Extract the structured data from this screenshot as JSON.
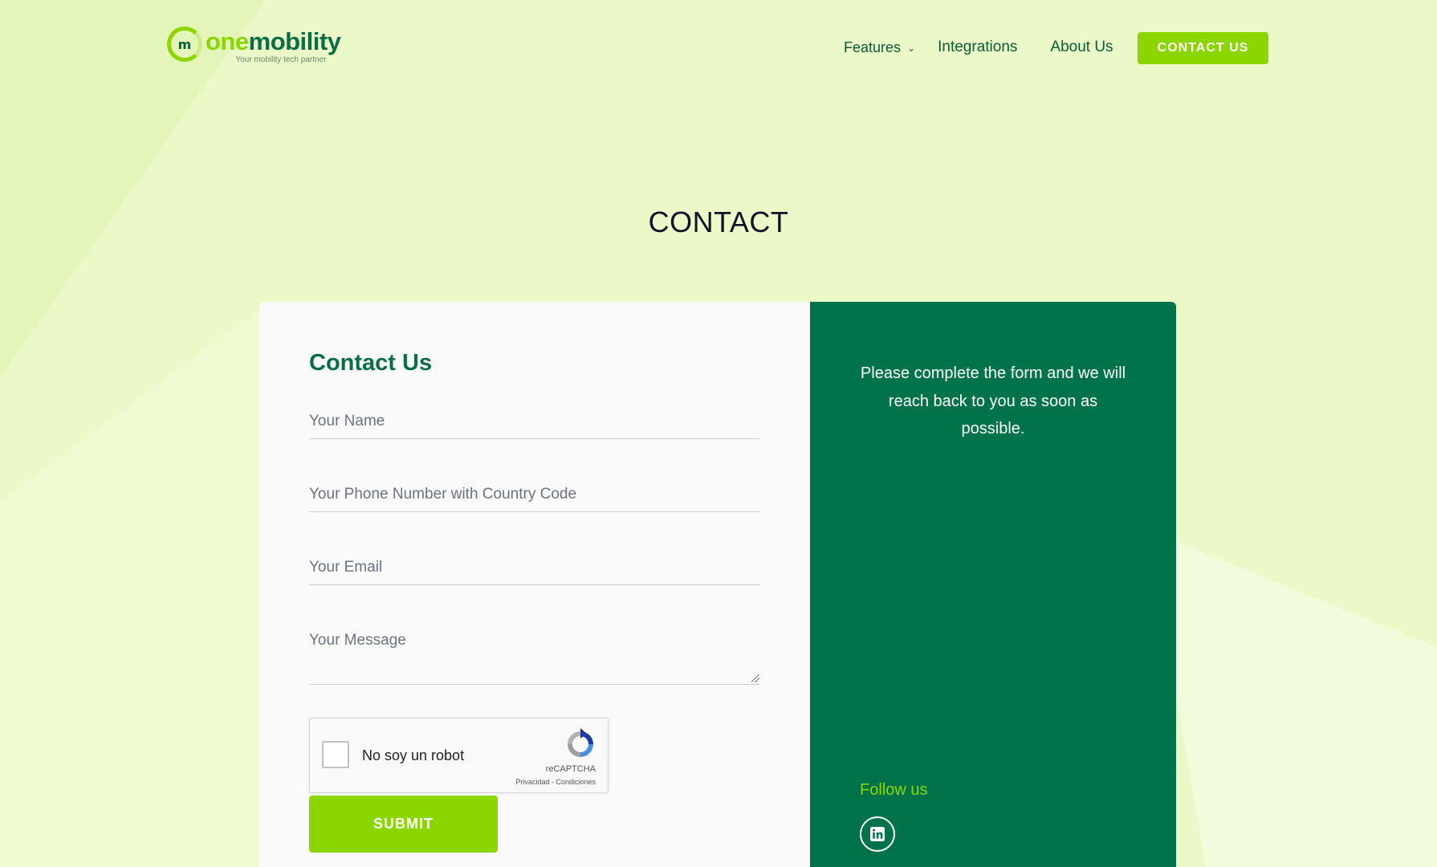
{
  "header": {
    "logo": {
      "one": "one",
      "mobility": "mobility",
      "tagline": "Your mobility tech partner",
      "mark": "m"
    },
    "nav": {
      "features": "Features",
      "integrations": "Integrations",
      "about": "About Us",
      "contact_button": "CONTACT US"
    }
  },
  "page": {
    "title": "CONTACT"
  },
  "form": {
    "title": "Contact Us",
    "name_placeholder": "Your Name",
    "phone_placeholder": "Your Phone Number with Country Code",
    "email_placeholder": "Your Email",
    "message_placeholder": "Your Message",
    "captcha": {
      "label": "No soy un robot",
      "brand": "reCAPTCHA",
      "links": "Privacidad - Condiciones"
    },
    "submit_label": "SUBMIT"
  },
  "info": {
    "text": "Please complete the form and we will reach back to you as soon as possible.",
    "follow_label": "Follow us",
    "social_icons": [
      "linkedin-icon"
    ]
  },
  "colors": {
    "accent": "#8cd600",
    "brand_dark": "#00734a",
    "background": "#ebf8c8"
  }
}
